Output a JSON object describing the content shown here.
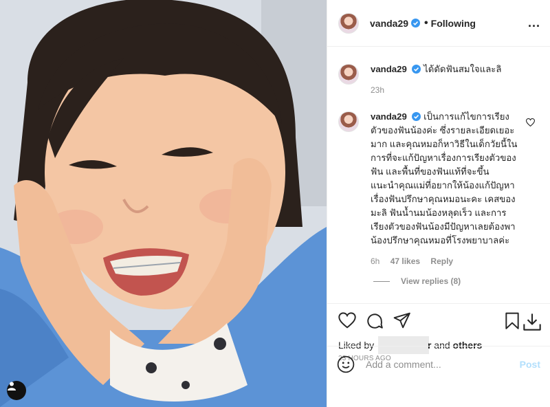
{
  "header": {
    "username": "vanda29",
    "separator": "•",
    "follow_status": "Following",
    "more": "..."
  },
  "caption": {
    "username": "vanda29",
    "text": "ได้ดัดฟันสมใจและลิ",
    "time": "23h"
  },
  "comment": {
    "username": "vanda29",
    "text": "เป็นการแก้ไขการเรียงตัวของฟันน้องค่ะ ซึ่งรายละเอียดเยอะมาก และคุณหมอก็หาวิธีในเด็กวัยนี้ในการที่จะแก้ปัญหาเรื่องการเรียงตัวของฟัน และพื้นที่ของฟันแท้ที่จะขึ้น แนะนำคุณแม่ที่อยากให้น้องแก้ปัญหาเรื่องฟันปรึกษาคุณหมอนะคะ เคสของมะลิ ฟันน้ำนมน้องหลุดเร็ว และการเรียงตัวของฟันน้องมีปัญหาเลยต้องพาน้องปรึกษาคุณหมอที่โรงพยาบาลค่ะ",
    "time": "6h",
    "likes": "47 likes",
    "reply": "Reply",
    "view_replies": "View replies (8)"
  },
  "likes": {
    "prefix": "Liked by",
    "suffix_char": "r",
    "and": "and",
    "others": "others"
  },
  "timestamp": "23 HOURS AGO",
  "add_comment": {
    "placeholder": "Add a comment...",
    "post_label": "Post"
  },
  "colors": {
    "verified": "#3897f0",
    "post_disabled": "#b2dffc",
    "muted": "#8e8e8e"
  },
  "icons": [
    "heart-icon",
    "comment-icon",
    "share-icon",
    "bookmark-icon",
    "download-icon",
    "emoji-icon",
    "user-tag-icon"
  ]
}
